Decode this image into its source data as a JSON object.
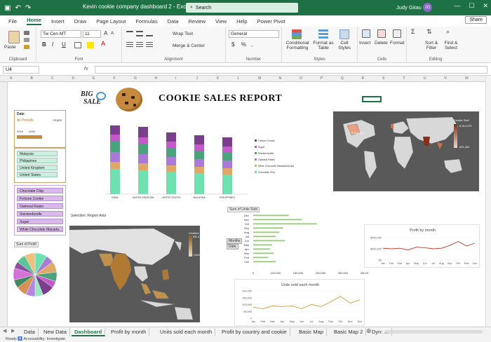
{
  "window": {
    "title": "Kevin cookie company dashboard 2  -  Excel",
    "search_placeholder": "Search",
    "user": "Judy Gitau",
    "avatar_initial": "JG",
    "minimize": "—",
    "maximize": "☐",
    "close": "✕"
  },
  "quick_access": {
    "autosave": "AutoSave",
    "undo": "↶",
    "redo": "↷"
  },
  "menu": [
    "File",
    "Home",
    "Insert",
    "Draw",
    "Page Layout",
    "Formulas",
    "Data",
    "Review",
    "View",
    "Help",
    "Power Pivot"
  ],
  "menu_active": "Home",
  "share": "Share",
  "ribbon": {
    "clipboard": {
      "paste": "Paste",
      "label": "Clipboard"
    },
    "font": {
      "name": "Tw Cen MT",
      "size": "11",
      "bold": "B",
      "italic": "I",
      "underline": "U",
      "label": "Font"
    },
    "alignment": {
      "wrap": "Wrap Text",
      "merge": "Merge & Center",
      "label": "Alignment"
    },
    "number": {
      "format": "General",
      "currency": "$",
      "percent": "%",
      "comma": ",",
      "label": "Number"
    },
    "styles": {
      "conditional": "Conditional Formatting",
      "table": "Format as Table",
      "cell": "Cell Styles",
      "label": "Styles"
    },
    "cells": {
      "insert": "Insert",
      "delete": "Delete",
      "format": "Format",
      "label": "Cells"
    },
    "editing": {
      "sort": "Sort & Filter",
      "find": "Find & Select",
      "label": "Editing"
    }
  },
  "formula_bar": {
    "cell_ref": "U4",
    "fx": "fx",
    "content": ""
  },
  "columns": [
    "A",
    "B",
    "C",
    "D",
    "E",
    "F",
    "G",
    "H",
    "I",
    "J",
    "K",
    "L",
    "M",
    "N",
    "O",
    "P",
    "Q",
    "R",
    "S",
    "T",
    "U",
    "V",
    "W"
  ],
  "dashboard": {
    "title": "COOKIE SALES REPORT",
    "logo_top": "BIG",
    "logo_bottom": "SALE",
    "date_slicer": {
      "title": "Date",
      "all_periods": "All Periods",
      "unit": "YEARS",
      "y1": "2019",
      "y2": "2020"
    },
    "country_slicer": [
      "Malaysia",
      "Philippines",
      "United Kingdom",
      "United States"
    ],
    "product_slicer": [
      "Chocolate Chip",
      "Fortune Cookie",
      "Oatmeal Raisin",
      "Snickerdoodle",
      "Sugar",
      "White Chocolate Macada..."
    ],
    "sum_profit_label": "Sum of Profit",
    "selection_label": "Selection: Region    Asia",
    "sum_units_label": "Sum of Units Sold",
    "months_label": "Months",
    "date_btn": "Date",
    "world_map": {
      "legend_title": "Cookie Sold",
      "max": "6,314,237",
      "min": "631,251",
      "highlight": "6,314,237"
    },
    "asia_map": {
      "legend_title": "Cookies Sold",
      "max": "631,4,225",
      "min": "1,93,8,71"
    },
    "stacked_legend": [
      "Fortune Cookie",
      "Sugar",
      "Snickerdoodle",
      "Oatmeal Raisin",
      "White Chocolate Macadamia Nut",
      "Chocolate Chip"
    ]
  },
  "chart_data": [
    {
      "type": "bar",
      "title": "",
      "categories": [
        "INDIA",
        "UNITED KINGDOM",
        "UNITED STATES",
        "MALAYSIA",
        "PHILIPPINES"
      ],
      "series": [
        {
          "name": "Chocolate Chip",
          "values": [
            36,
            34,
            32,
            30,
            28
          ]
        },
        {
          "name": "White Chocolate Macadamia Nut",
          "values": [
            10,
            10,
            9,
            9,
            9
          ]
        },
        {
          "name": "Oatmeal Raisin",
          "values": [
            14,
            13,
            12,
            11,
            11
          ]
        },
        {
          "name": "Snickerdoodle",
          "values": [
            15,
            14,
            13,
            12,
            11
          ]
        },
        {
          "name": "Sugar",
          "values": [
            10,
            10,
            9,
            9,
            9
          ]
        },
        {
          "name": "Fortune Cookie",
          "values": [
            13,
            15,
            13,
            13,
            13
          ]
        }
      ],
      "colors": [
        "#6fe0b0",
        "#e0a868",
        "#a97ad8",
        "#4aa37a",
        "#c25ac8",
        "#7a3f8a"
      ]
    },
    {
      "type": "bar",
      "orientation": "horizontal",
      "title": "",
      "categories": [
        "Dec",
        "Nov",
        "Oct",
        "Sep",
        "Aug",
        "Jul",
        "Jun",
        "May",
        "Apr",
        "Mar",
        "Feb",
        "Jan"
      ],
      "values": [
        95000,
        130000,
        170000,
        80000,
        70000,
        60000,
        85000,
        50000,
        45000,
        55000,
        40000,
        60000
      ],
      "xticks": [
        "0",
        "100,000",
        "150,000",
        "200,000",
        "250,000",
        "300,000"
      ],
      "xlim": [
        0,
        300000
      ]
    },
    {
      "type": "line",
      "title": "Profit by month",
      "categories": [
        "Jan",
        "Feb",
        "Mar",
        "Apr",
        "May",
        "Jun",
        "Jul",
        "Aug",
        "Sep",
        "Oct",
        "Nov",
        "Dec"
      ],
      "values": [
        210000,
        200000,
        210000,
        180000,
        230000,
        220000,
        200000,
        210000,
        260000,
        330000,
        250000,
        300000
      ],
      "yticks": [
        "$400,000",
        "$200,000",
        "$0"
      ],
      "ylim": [
        0,
        400000
      ]
    },
    {
      "type": "line",
      "title": "Units sold each month",
      "categories": [
        "Jan",
        "Feb",
        "Mar",
        "Apr",
        "May",
        "Jun",
        "Jul",
        "Aug",
        "Sep",
        "Oct",
        "Nov",
        "Dec"
      ],
      "values": [
        80000,
        70000,
        90000,
        85000,
        90000,
        70000,
        100000,
        85000,
        120000,
        160000,
        110000,
        135000
      ],
      "yticks": [
        "200,000",
        "150,000",
        "100,000",
        "50,000",
        "0"
      ],
      "ylim": [
        0,
        200000
      ]
    },
    {
      "type": "pie",
      "title": "",
      "values": [
        9,
        6,
        8,
        7,
        5,
        9,
        6,
        7,
        8,
        6,
        9,
        5,
        7,
        8
      ],
      "colors": [
        "#6fe0b0",
        "#a97ad8",
        "#e0a868",
        "#4aa37a",
        "#c25ac8",
        "#7a3f8a",
        "#98e6c8",
        "#b785e0",
        "#d99052",
        "#3f8a63",
        "#d671d8",
        "#8d4fa0",
        "#58c796",
        "#f0c080"
      ]
    }
  ],
  "sheet_tabs": [
    "Data",
    "New Data",
    "Dashboard",
    "Profit by month",
    "Units sold each month",
    "Profit by country and cookie",
    "Basic Map",
    "Basic Map 2",
    "Dyn: ..."
  ],
  "active_tab": "Dashboard",
  "status": "Ready    ♿ Accessibility: Investigate"
}
